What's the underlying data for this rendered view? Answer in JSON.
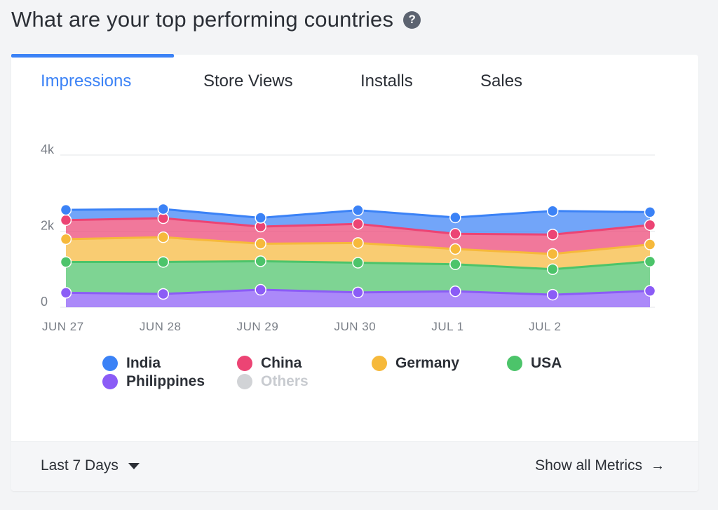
{
  "header": {
    "title": "What are your top performing countries",
    "help_icon": "question-circle-icon"
  },
  "tabs": [
    {
      "label": "Impressions",
      "active": true
    },
    {
      "label": "Store Views",
      "active": false
    },
    {
      "label": "Installs",
      "active": false
    },
    {
      "label": "Sales",
      "active": false
    }
  ],
  "colors": {
    "accent": "#3b82f6"
  },
  "chart_data": {
    "type": "area",
    "stacked": true,
    "categories": [
      "JUN 27",
      "JUN 28",
      "JUN 29",
      "JUN 30",
      "JUL 1",
      "JUL 2",
      ""
    ],
    "y_ticks": [
      "0",
      "2k",
      "4k"
    ],
    "ylim": [
      0,
      4000
    ],
    "grid": "horizontal",
    "legend_position": "bottom",
    "series": [
      {
        "name": "Philippines",
        "color": "#8b5cf6",
        "values": [
          380,
          350,
          460,
          390,
          420,
          330,
          430
        ]
      },
      {
        "name": "USA",
        "color": "#4cc46a",
        "values": [
          810,
          840,
          750,
          780,
          710,
          670,
          770
        ]
      },
      {
        "name": "Germany",
        "color": "#f6b93b",
        "values": [
          600,
          650,
          460,
          520,
          400,
          400,
          450
        ]
      },
      {
        "name": "China",
        "color": "#ec4474",
        "values": [
          500,
          500,
          450,
          500,
          400,
          510,
          510
        ]
      },
      {
        "name": "India",
        "color": "#3b82f6",
        "values": [
          270,
          240,
          230,
          360,
          430,
          620,
          340
        ]
      }
    ]
  },
  "legend": [
    {
      "name": "India",
      "color": "#3b82f6",
      "enabled": true
    },
    {
      "name": "China",
      "color": "#ec4474",
      "enabled": true
    },
    {
      "name": "Germany",
      "color": "#f6b93b",
      "enabled": true
    },
    {
      "name": "USA",
      "color": "#4cc46a",
      "enabled": true
    },
    {
      "name": "Philippines",
      "color": "#8b5cf6",
      "enabled": true
    },
    {
      "name": "Others",
      "color": "#d1d3d6",
      "enabled": false
    }
  ],
  "footer": {
    "range_label": "Last 7 Days",
    "show_all_label": "Show all Metrics",
    "arrow": "→"
  }
}
